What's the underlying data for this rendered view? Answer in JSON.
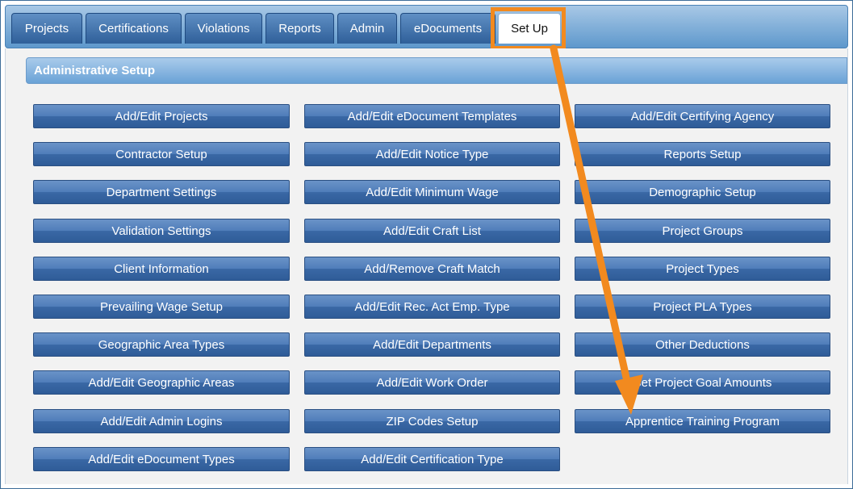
{
  "tabs": [
    {
      "label": "Projects"
    },
    {
      "label": "Certifications"
    },
    {
      "label": "Violations"
    },
    {
      "label": "Reports"
    },
    {
      "label": "Admin"
    },
    {
      "label": "eDocuments"
    },
    {
      "label": "Set Up",
      "active": true
    }
  ],
  "section": {
    "title": "Administrative Setup"
  },
  "columns": [
    [
      "Add/Edit Projects",
      "Contractor Setup",
      "Department Settings",
      "Validation Settings",
      "Client Information",
      "Prevailing Wage Setup",
      "Geographic Area Types",
      "Add/Edit Geographic Areas",
      "Add/Edit Admin Logins",
      "Add/Edit eDocument Types"
    ],
    [
      "Add/Edit eDocument Templates",
      "Add/Edit Notice Type",
      "Add/Edit Minimum Wage",
      "Add/Edit Craft List",
      "Add/Remove Craft Match",
      "Add/Edit Rec. Act Emp. Type",
      "Add/Edit Departments",
      "Add/Edit Work Order",
      "ZIP Codes Setup",
      "Add/Edit Certification Type"
    ],
    [
      "Add/Edit Certifying Agency",
      "Reports Setup",
      "Demographic Setup",
      "Project Groups",
      "Project Types",
      "Project PLA Types",
      "Other Deductions",
      "Set Project Goal Amounts",
      "Apprentice Training Program"
    ]
  ],
  "annotation_color": "#f28a1f"
}
